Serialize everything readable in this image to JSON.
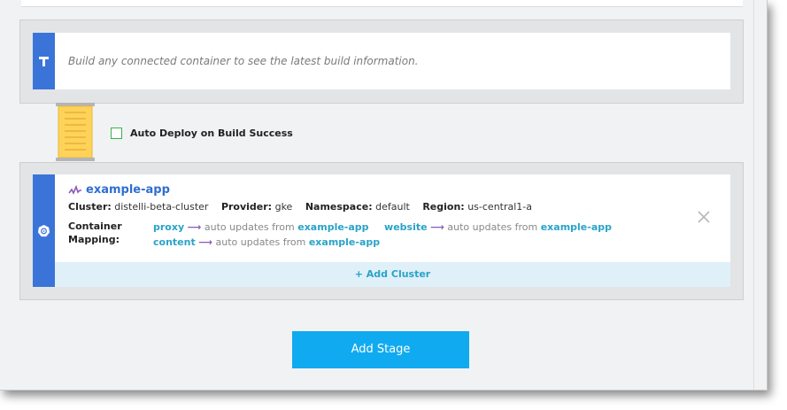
{
  "build": {
    "message": "Build any connected container to see the latest build information.",
    "icon": "build-hammer-icon"
  },
  "auto_deploy": {
    "label": "Auto Deploy on Build Success",
    "checked": false
  },
  "cluster": {
    "app_name": "example-app",
    "cluster_label": "Cluster:",
    "cluster_value": "distelli-beta-cluster",
    "provider_label": "Provider:",
    "provider_value": "gke",
    "namespace_label": "Namespace:",
    "namespace_value": "default",
    "region_label": "Region:",
    "region_value": "us-central1-a",
    "mapping_label_1": "Container",
    "mapping_label_2": "Mapping:",
    "mappings": [
      {
        "service": "proxy",
        "text": "auto updates from",
        "target": "example-app"
      },
      {
        "service": "website",
        "text": "auto updates from",
        "target": "example-app"
      },
      {
        "service": "content",
        "text": "auto updates from",
        "target": "example-app"
      }
    ],
    "add_cluster_label": "+ Add Cluster"
  },
  "add_stage_label": "Add Stage",
  "colors": {
    "stripe": "#3b74d8",
    "accent": "#2aa3c7",
    "arrow": "#8a5ab8",
    "button": "#10aaf0",
    "checkbox": "#3cb04b"
  }
}
